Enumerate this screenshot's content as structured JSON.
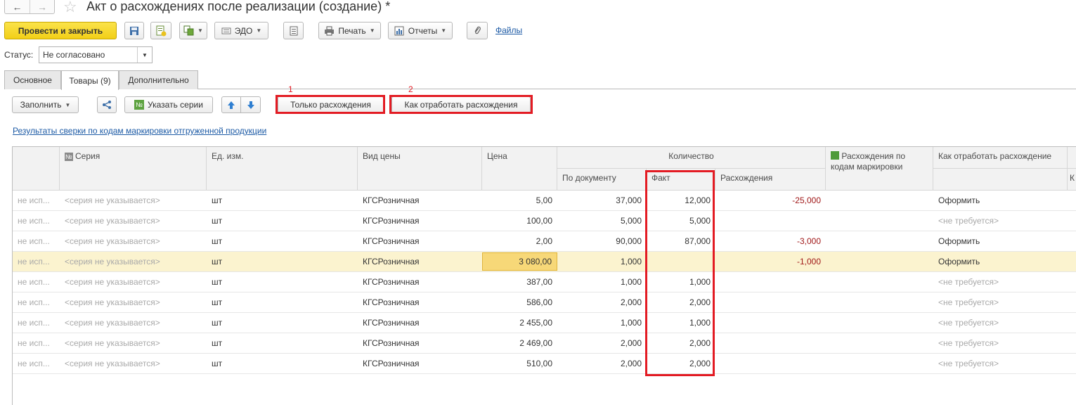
{
  "window": {
    "title": "Акт о расхождениях после реализации (создание) *",
    "back_icon": "←",
    "forward_icon": "→",
    "star_icon": "☆"
  },
  "toolbar": {
    "post_close": "Провести и закрыть",
    "edo": "ЭДО",
    "print": "Печать",
    "reports": "Отчеты",
    "files": "Файлы"
  },
  "status": {
    "label": "Статус:",
    "value": "Не согласовано"
  },
  "tabs": [
    "Основное",
    "Товары (9)",
    "Дополнительно"
  ],
  "table_toolbar": {
    "fill": "Заполнить",
    "series": "Указать серии",
    "only_diff": "Только расхождения",
    "how_process": "Как отработать расхождения",
    "num1": "1",
    "num2": "2",
    "results_link": "Результаты сверки по кодам маркировки отгруженной продукции"
  },
  "columns": {
    "series_icon": "№",
    "series": "Серия",
    "unit": "Ед. изм.",
    "price_type": "Вид цены",
    "price": "Цена",
    "quantity": "Количество",
    "by_doc": "По документу",
    "fact": "Факт",
    "diff": "Расхождения",
    "marking_diff": "Расхождения по кодам маркировки",
    "how_process": "Как отработать расхождение",
    "cut": "К"
  },
  "rows": [
    {
      "c1": "не исп...",
      "series": "<серия не указывается>",
      "unit": "шт",
      "price_type": "КГСРозничная",
      "price": "5,00",
      "doc": "37,000",
      "fact": "12,000",
      "diff": "-25,000",
      "action": "Оформить"
    },
    {
      "c1": "не исп...",
      "series": "<серия не указывается>",
      "unit": "шт",
      "price_type": "КГСРозничная",
      "price": "100,00",
      "doc": "5,000",
      "fact": "5,000",
      "diff": "",
      "action": "<не требуется>"
    },
    {
      "c1": "не исп...",
      "series": "<серия не указывается>",
      "unit": "шт",
      "price_type": "КГСРозничная",
      "price": "2,00",
      "doc": "90,000",
      "fact": "87,000",
      "diff": "-3,000",
      "action": "Оформить"
    },
    {
      "c1": "не исп...",
      "series": "<серия не указывается>",
      "unit": "шт",
      "price_type": "КГСРозничная",
      "price": "3 080,00",
      "doc": "1,000",
      "fact": "",
      "diff": "-1,000",
      "action": "Оформить"
    },
    {
      "c1": "не исп...",
      "series": "<серия не указывается>",
      "unit": "шт",
      "price_type": "КГСРозничная",
      "price": "387,00",
      "doc": "1,000",
      "fact": "1,000",
      "diff": "",
      "action": "<не требуется>"
    },
    {
      "c1": "не исп...",
      "series": "<серия не указывается>",
      "unit": "шт",
      "price_type": "КГСРозничная",
      "price": "586,00",
      "doc": "2,000",
      "fact": "2,000",
      "diff": "",
      "action": "<не требуется>"
    },
    {
      "c1": "не исп...",
      "series": "<серия не указывается>",
      "unit": "шт",
      "price_type": "КГСРозничная",
      "price": "2 455,00",
      "doc": "1,000",
      "fact": "1,000",
      "diff": "",
      "action": "<не требуется>"
    },
    {
      "c1": "не исп...",
      "series": "<серия не указывается>",
      "unit": "шт",
      "price_type": "КГСРозничная",
      "price": "2 469,00",
      "doc": "2,000",
      "fact": "2,000",
      "diff": "",
      "action": "<не требуется>"
    },
    {
      "c1": "не исп...",
      "series": "<серия не указывается>",
      "unit": "шт",
      "price_type": "КГСРозничная",
      "price": "510,00",
      "doc": "2,000",
      "fact": "2,000",
      "diff": "",
      "action": "<не требуется>"
    }
  ]
}
